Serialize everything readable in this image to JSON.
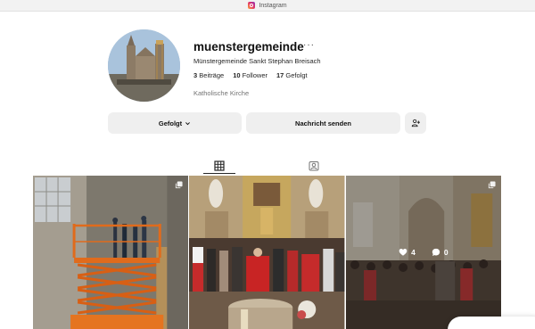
{
  "window": {
    "title": "Instagram",
    "app_icon": "instagram-icon"
  },
  "profile": {
    "username": "muenstergemeinde",
    "more_icon": "more-horizontal-icon",
    "full_name": "Münstergemeinde Sankt Stephan Breisach",
    "stats": [
      {
        "count": "3",
        "label": "Beiträge"
      },
      {
        "count": "10",
        "label": "Follower"
      },
      {
        "count": "17",
        "label": "Gefolgt"
      }
    ],
    "category": "Katholische Kirche"
  },
  "actions": {
    "follow_label": "Gefolgt",
    "follow_icon": "chevron-down-icon",
    "message_label": "Nachricht senden",
    "add_person_icon": "person-add-icon"
  },
  "tabs": [
    {
      "name": "posts",
      "icon": "grid-icon",
      "active": true
    },
    {
      "name": "tagged",
      "icon": "tagged-person-icon",
      "active": false
    }
  ],
  "posts": [
    {
      "subject": "scissor lift in church",
      "multi_icon": "carousel-icon"
    },
    {
      "subject": "mass at altar",
      "multi_icon": ""
    },
    {
      "subject": "congregation in nave",
      "multi_icon": "carousel-icon",
      "hover": {
        "likes": "4",
        "comments": "0"
      }
    }
  ],
  "colors": {
    "text": "#262626",
    "secondary": "#737373",
    "button_bg": "#efefef"
  }
}
